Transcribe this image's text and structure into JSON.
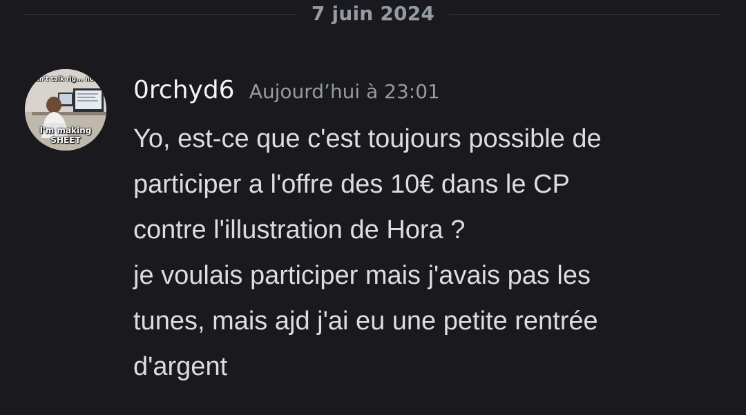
{
  "divider": {
    "date": "7 juin 2024"
  },
  "message": {
    "author": "0rchyd6",
    "timestamp": "Aujourd’hui à 23:01",
    "avatar": {
      "caption_top": "can't talk rig... now",
      "caption_bottom_1": "I'm making",
      "caption_bottom_2": "SHEET"
    },
    "lines": [
      "Yo, est-ce que c'est toujours possible de",
      "participer a l'offre des 10€ dans le CP",
      "contre l'illustration de Hora ?",
      "je voulais participer mais j'avais pas les",
      "tunes, mais ajd j'ai eu une petite rentrée",
      "d'argent"
    ]
  }
}
